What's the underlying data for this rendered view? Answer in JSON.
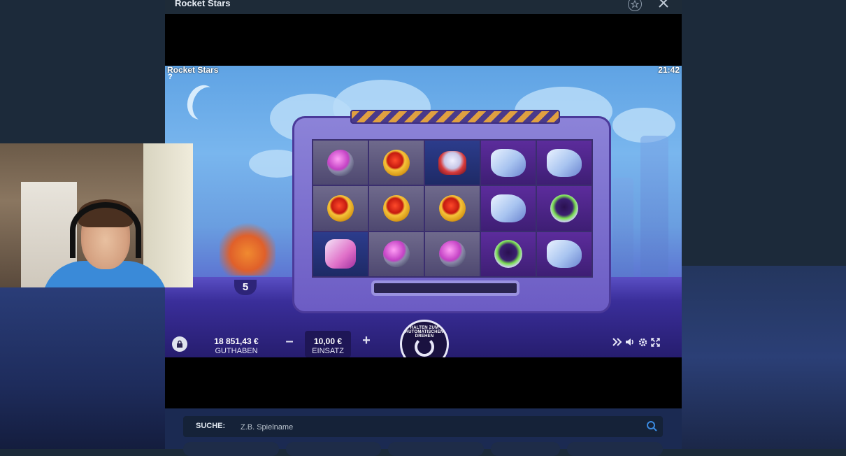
{
  "window": {
    "title": "Rocket Stars"
  },
  "game": {
    "name": "Rocket Stars",
    "help": "?",
    "clock": "21:42",
    "counter": "5",
    "reels": [
      [
        "pink-gem",
        "gold-gem",
        "rocket",
        "glove",
        "glove"
      ],
      [
        "gold-gem",
        "gold-gem",
        "gold-gem",
        "glove",
        "alien"
      ],
      [
        "boots",
        "pink-gem",
        "pink-gem",
        "alien",
        "glove"
      ]
    ],
    "balance": {
      "value": "18 851,43 €",
      "label": "GUTHABEN"
    },
    "bet": {
      "value": "10,00 €",
      "label": "EINSATZ"
    },
    "spin_hint": "HALTEN ZUM AUTOMATISCHEN DREHEN"
  },
  "search": {
    "label": "SUCHE:",
    "placeholder": "Z.B. Spielname"
  },
  "colors": {
    "header_bg": "#1e2b38",
    "page_bg": "#1c2a3a",
    "game_sky": "#79b6ee"
  }
}
